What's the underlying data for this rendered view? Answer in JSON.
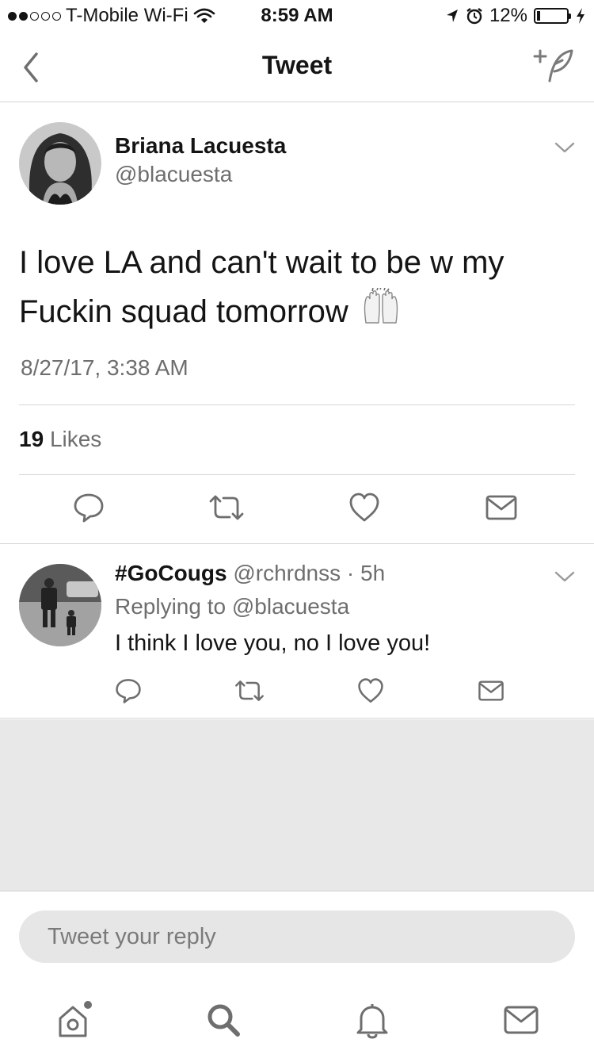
{
  "status_bar": {
    "carrier": "T-Mobile Wi-Fi",
    "time": "8:59 AM",
    "battery": "12%",
    "battery_level": 0.12,
    "signal_bars_filled": 2,
    "signal_bars_total": 5,
    "icons": [
      "wifi-icon",
      "location-arrow-icon",
      "alarm-icon",
      "battery-icon",
      "charging-bolt-icon"
    ]
  },
  "nav": {
    "title": "Tweet",
    "back_icon": "chevron-left-icon",
    "compose_icon": "compose-tweet-icon"
  },
  "tweet": {
    "author_name": "Briana Lacuesta",
    "author_handle": "@blacuesta",
    "text": "I love LA and can't wait to be w my Fuckin squad tomorrow",
    "emoji": "raising-hands-emoji",
    "timestamp": "8/27/17, 3:38 AM",
    "likes_count": "19",
    "likes_label": "Likes",
    "actions": [
      "reply-icon",
      "retweet-icon",
      "like-icon",
      "direct-message-icon"
    ]
  },
  "reply": {
    "author_name": "#GoCougs",
    "author_handle": "@rchrdnss",
    "separator": "·",
    "time_ago": "5h",
    "replying_to": "Replying to @blacuesta",
    "text": "I think I love you, no I love you!",
    "actions": [
      "reply-icon",
      "retweet-icon",
      "like-icon",
      "direct-message-icon"
    ]
  },
  "composer": {
    "placeholder": "Tweet your reply"
  },
  "tab_bar": {
    "tabs": [
      "home-icon",
      "search-icon",
      "notifications-icon",
      "messages-icon"
    ]
  },
  "colors": {
    "text_primary": "#141414",
    "text_secondary": "#6e6e6e",
    "divider": "#d6d6d6",
    "empty_background": "#e8e8e8",
    "input_background": "#e6e6e6"
  }
}
